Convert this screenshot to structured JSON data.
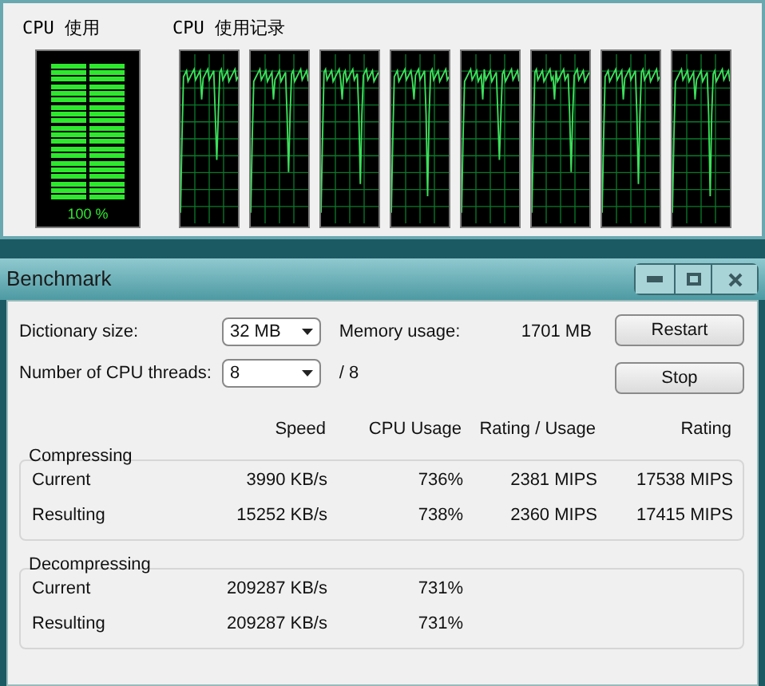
{
  "cpu_usage": {
    "title": "CPU 使用",
    "level": 1,
    "reading": "100 %"
  },
  "cpu_history": {
    "title": "CPU 使用记录"
  },
  "window": {
    "title": "Benchmark"
  },
  "settings": [
    {
      "label": "Dictionary size:",
      "value": "32 MB"
    },
    {
      "label": "Number of CPU threads:",
      "value": "8"
    }
  ],
  "memory_usage": {
    "label": "Memory usage:",
    "value": "1701 MB"
  },
  "threads_total": "/ 8",
  "buttons": [
    "Restart",
    "Stop"
  ],
  "columns": [
    "Speed",
    "CPU Usage",
    "Rating / Usage",
    "Rating"
  ],
  "groups": [
    {
      "title": "Compressing",
      "rows": [
        {
          "name": "Current",
          "cells": [
            "3990 KB/s",
            "736%",
            "2381 MIPS",
            "17538 MIPS"
          ]
        },
        {
          "name": "Resulting",
          "cells": [
            "15252 KB/s",
            "738%",
            "2360 MIPS",
            "17415 MIPS"
          ]
        }
      ]
    },
    {
      "title": "Decompressing",
      "rows": [
        {
          "name": "Current",
          "cells": [
            "209287 KB/s",
            "731%"
          ]
        },
        {
          "name": "Resulting",
          "cells": [
            "209287 KB/s",
            "731%"
          ]
        }
      ]
    }
  ]
}
